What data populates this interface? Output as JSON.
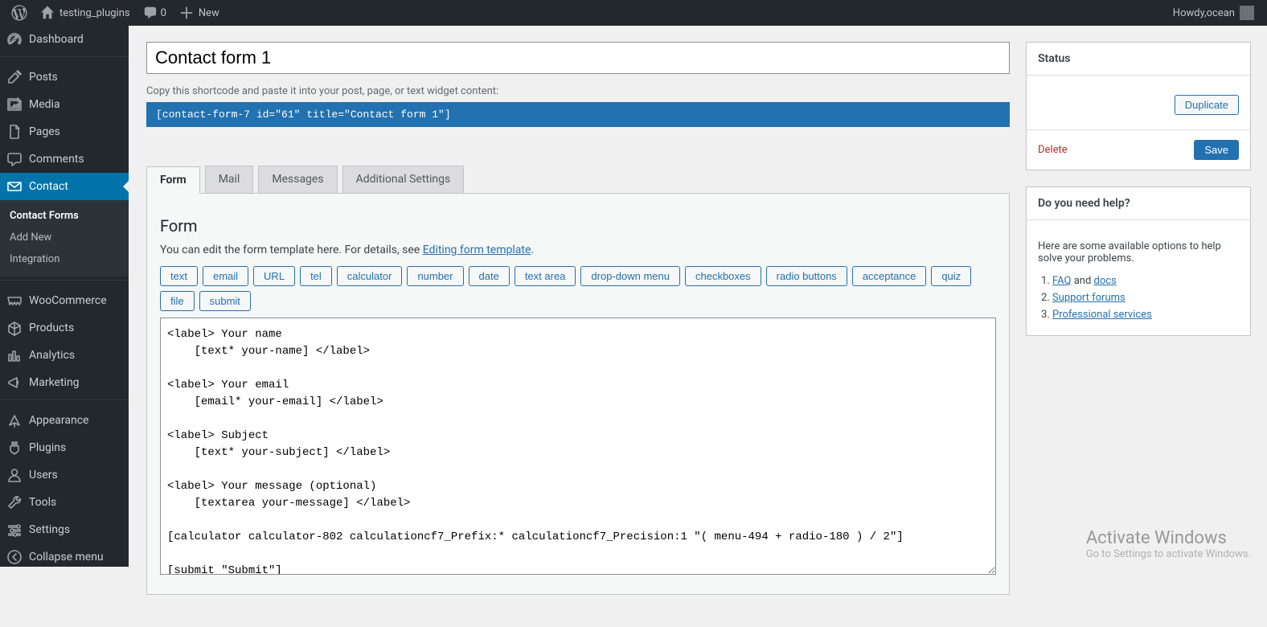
{
  "adminbar": {
    "site_name": "testing_plugins",
    "comments_count": "0",
    "new_label": "New",
    "howdy_prefix": "Howdy, ",
    "user_name": "ocean"
  },
  "menu": {
    "items": [
      {
        "id": "dashboard",
        "label": "Dashboard"
      },
      {
        "id": "posts",
        "label": "Posts"
      },
      {
        "id": "media",
        "label": "Media"
      },
      {
        "id": "pages",
        "label": "Pages"
      },
      {
        "id": "comments",
        "label": "Comments"
      },
      {
        "id": "contact",
        "label": "Contact",
        "current": true,
        "submenu": [
          {
            "id": "contact-forms",
            "label": "Contact Forms",
            "current": true
          },
          {
            "id": "add-new",
            "label": "Add New"
          },
          {
            "id": "integration",
            "label": "Integration"
          }
        ]
      },
      {
        "id": "woocommerce",
        "label": "WooCommerce"
      },
      {
        "id": "products",
        "label": "Products"
      },
      {
        "id": "analytics",
        "label": "Analytics"
      },
      {
        "id": "marketing",
        "label": "Marketing"
      },
      {
        "id": "appearance",
        "label": "Appearance"
      },
      {
        "id": "plugins",
        "label": "Plugins"
      },
      {
        "id": "users",
        "label": "Users"
      },
      {
        "id": "tools",
        "label": "Tools"
      },
      {
        "id": "settings",
        "label": "Settings"
      },
      {
        "id": "collapse",
        "label": "Collapse menu"
      }
    ]
  },
  "page": {
    "title_value": "Contact form 1",
    "shortcode_note": "Copy this shortcode and paste it into your post, page, or text widget content:",
    "shortcode": "[contact-form-7 id=\"61\" title=\"Contact form 1\"]"
  },
  "tabs": [
    {
      "id": "form",
      "label": "Form",
      "active": true
    },
    {
      "id": "mail",
      "label": "Mail"
    },
    {
      "id": "messages",
      "label": "Messages"
    },
    {
      "id": "addl",
      "label": "Additional Settings"
    }
  ],
  "form_panel": {
    "heading": "Form",
    "desc_prefix": "You can edit the form template here. For details, see ",
    "desc_link": "Editing form template",
    "desc_suffix": ".",
    "tags": [
      "text",
      "email",
      "URL",
      "tel",
      "calculator",
      "number",
      "date",
      "text area",
      "drop-down menu",
      "checkboxes",
      "radio buttons",
      "acceptance",
      "quiz",
      "file",
      "submit"
    ],
    "template": "<label> Your name\n    [text* your-name] </label>\n\n<label> Your email\n    [email* your-email] </label>\n\n<label> Subject\n    [text* your-subject] </label>\n\n<label> Your message (optional)\n    [textarea your-message] </label>\n\n[calculator calculator-802 calculationcf7_Prefix:* calculationcf7_Precision:1 \"( menu-494 + radio-180 ) / 2\"]\n\n[submit \"Submit\"]"
  },
  "status_box": {
    "heading": "Status",
    "duplicate": "Duplicate",
    "delete": "Delete",
    "save": "Save"
  },
  "help_box": {
    "heading": "Do you need help?",
    "intro": "Here are some available options to help solve your problems."
  },
  "help_links": {
    "faq": "FAQ",
    "and": " and ",
    "docs": "docs",
    "forums": "Support forums",
    "pro": "Professional services"
  },
  "watermark": {
    "l1": "Activate Windows",
    "l2": "Go to Settings to activate Windows."
  }
}
